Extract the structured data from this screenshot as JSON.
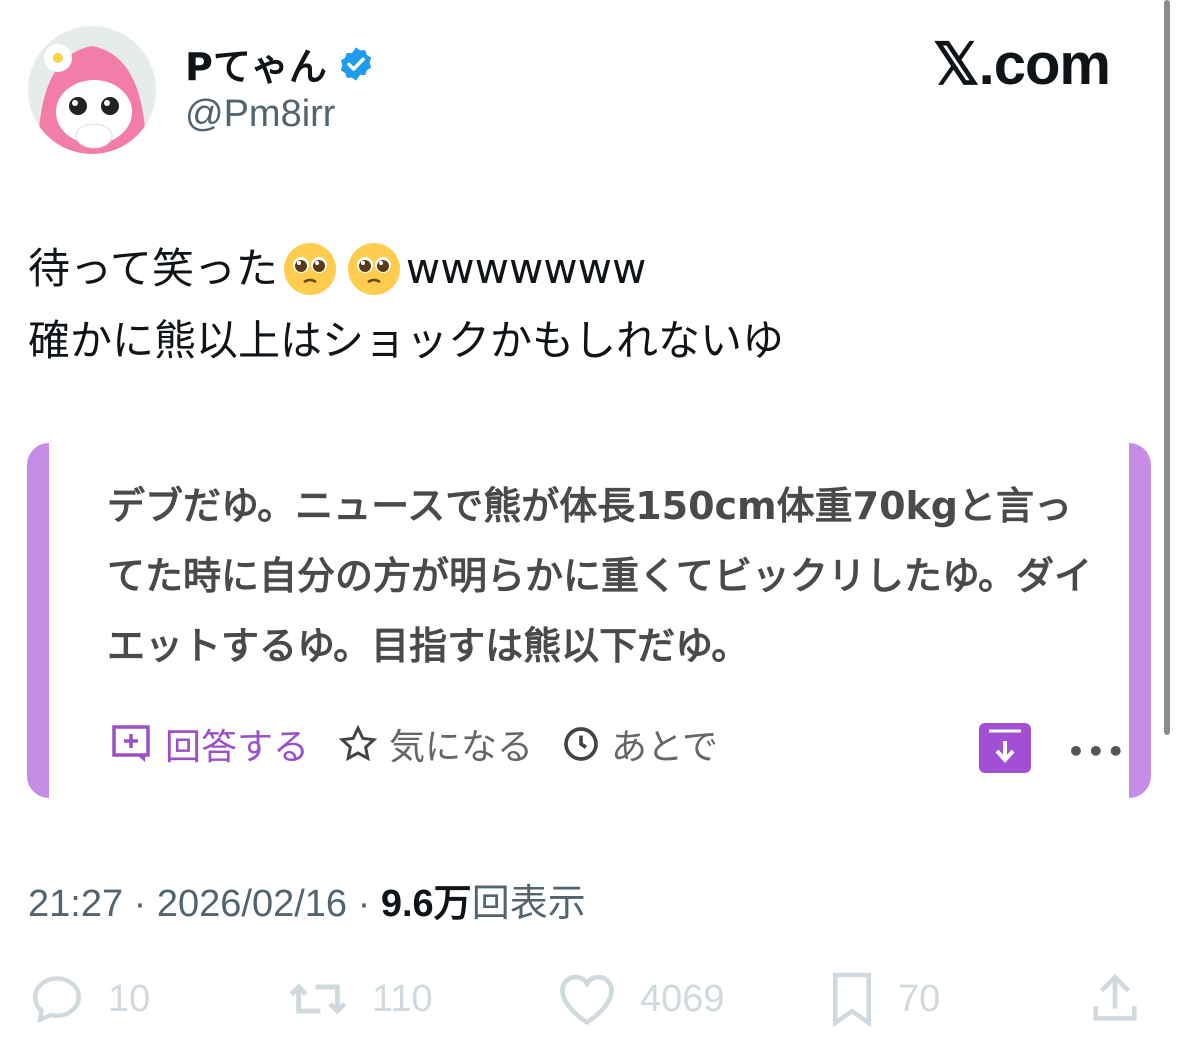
{
  "author": {
    "display_name": "Pてゃん",
    "handle": "@Pm8irr",
    "verified": true
  },
  "site_logo": "𝕏.com",
  "tweet": {
    "line1_text": "待って笑った",
    "line1_suffix": "wwwwwww",
    "line1_emoji": [
      "pleading-face",
      "pleading-face"
    ],
    "line2": "確かに熊以上はショックかもしれないゆ"
  },
  "embedded_card": {
    "text": "デブだゆ。ニュースで熊が体長150cm体重70kgと言ってた時に自分の方が明らかに重くてビックリしたゆ。ダイエットするゆ。目指すは熊以下だゆ。",
    "actions": {
      "answer": "回答する",
      "interest": "気になる",
      "later": "あとで"
    },
    "accent_color": "#c78ce6"
  },
  "meta": {
    "time": "21:27",
    "date": "2026/02/16",
    "views_number": "9.6",
    "views_unit": "万",
    "views_label": "回表示"
  },
  "stats": {
    "replies": "10",
    "retweets": "110",
    "likes": "4069",
    "bookmarks": "70"
  }
}
